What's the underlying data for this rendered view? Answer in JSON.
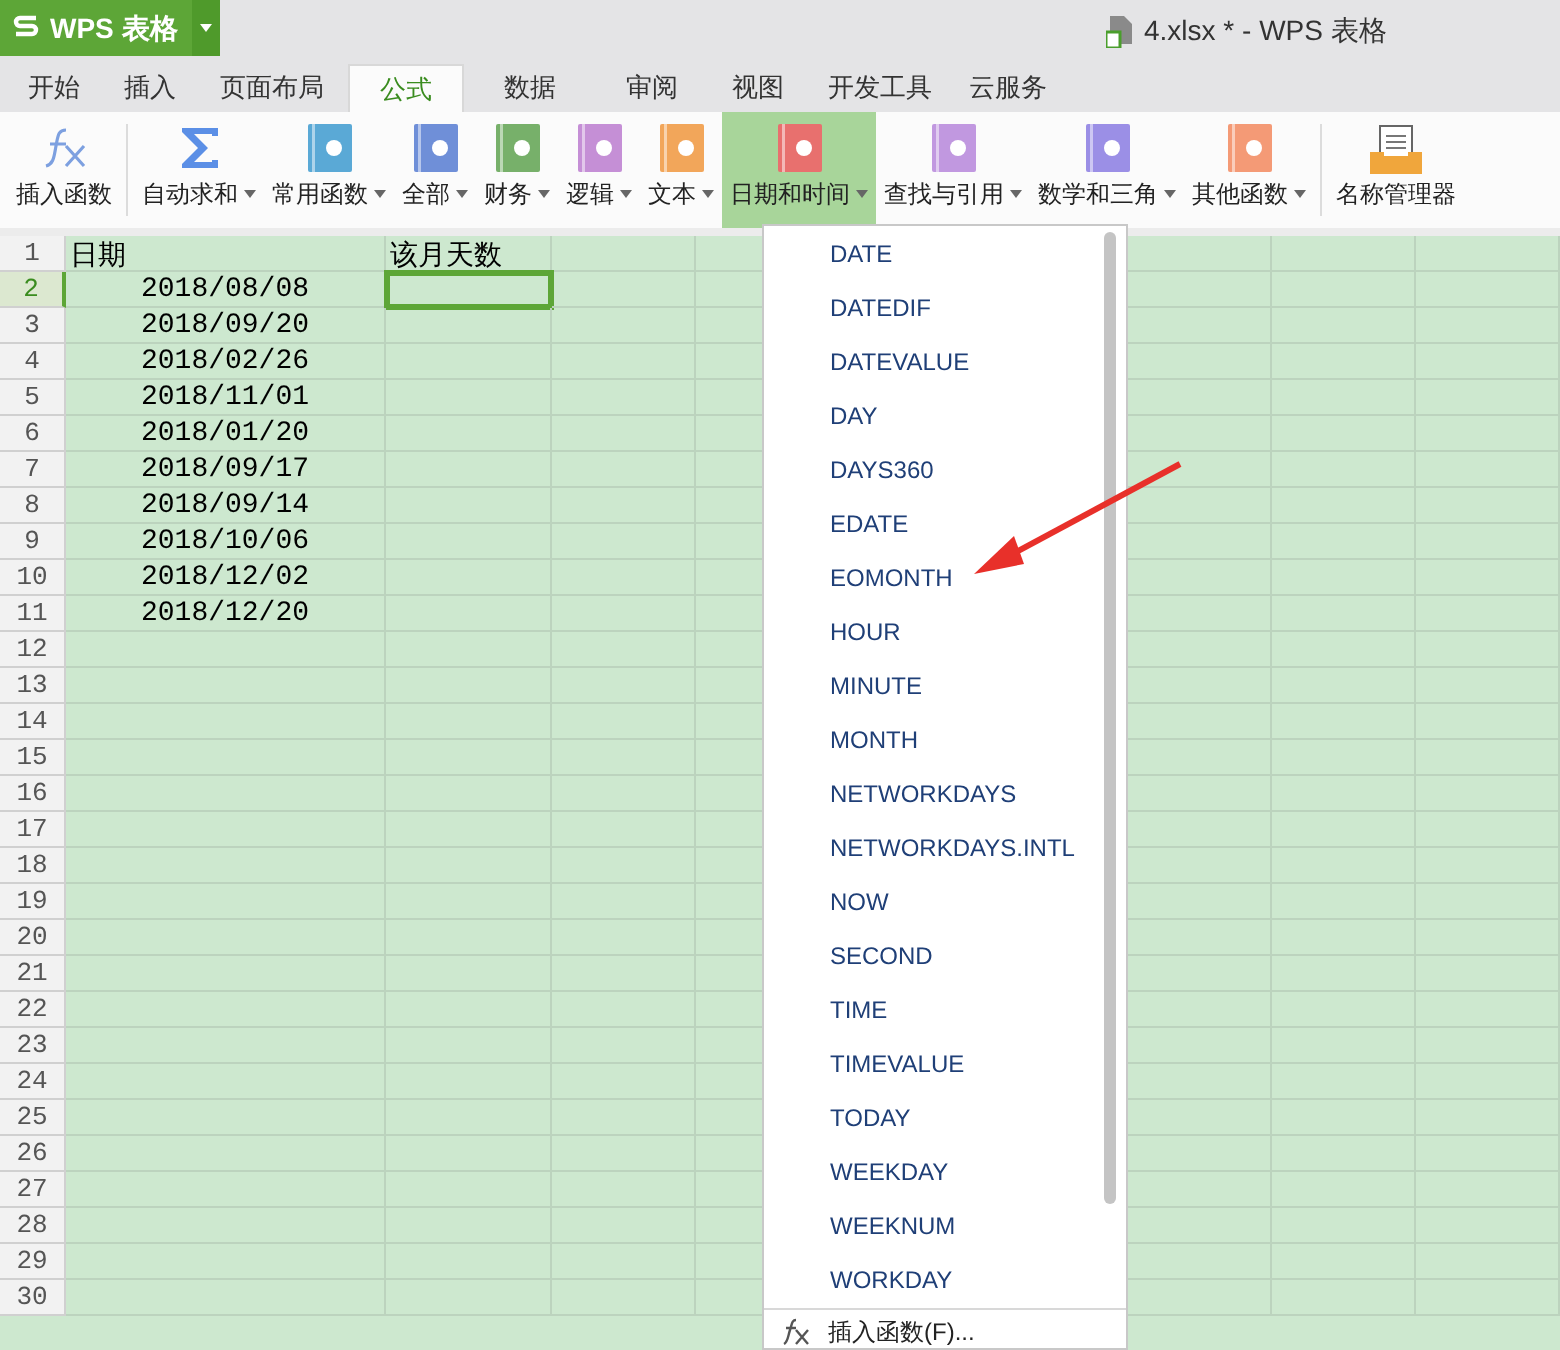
{
  "title_bar": {
    "app_button": "WPS 表格",
    "document_title": "4.xlsx * - WPS 表格"
  },
  "tabs": [
    {
      "label": "开始",
      "selected": false
    },
    {
      "label": "插入",
      "selected": false
    },
    {
      "label": "页面布局",
      "selected": false
    },
    {
      "label": "公式",
      "selected": true
    },
    {
      "label": "数据",
      "selected": false
    },
    {
      "label": "审阅",
      "selected": false
    },
    {
      "label": "视图",
      "selected": false
    },
    {
      "label": "开发工具",
      "selected": false
    },
    {
      "label": "云服务",
      "selected": false
    }
  ],
  "ribbon": [
    {
      "label": "插入函数",
      "kind": "fx",
      "dropdown": false,
      "selected": false
    },
    {
      "label": "自动求和",
      "kind": "sigma",
      "dropdown": true,
      "selected": false
    },
    {
      "label": "常用函数",
      "kind": "book",
      "color": "#5aa9d6",
      "dropdown": true,
      "selected": false
    },
    {
      "label": "全部",
      "kind": "book",
      "color": "#6f8fd8",
      "dropdown": true,
      "selected": false
    },
    {
      "label": "财务",
      "kind": "book",
      "color": "#77b06a",
      "dropdown": true,
      "selected": false
    },
    {
      "label": "逻辑",
      "kind": "book",
      "color": "#c58fd6",
      "dropdown": true,
      "selected": false
    },
    {
      "label": "文本",
      "kind": "book",
      "color": "#f2a65a",
      "dropdown": true,
      "selected": false
    },
    {
      "label": "日期和时间",
      "kind": "book",
      "color": "#e8706e",
      "dropdown": true,
      "selected": true
    },
    {
      "label": "查找与引用",
      "kind": "book",
      "color": "#c198e0",
      "dropdown": true,
      "selected": false
    },
    {
      "label": "数学和三角",
      "kind": "book",
      "color": "#9b8fe6",
      "dropdown": true,
      "selected": false
    },
    {
      "label": "其他函数",
      "kind": "book",
      "color": "#f49a76",
      "dropdown": true,
      "selected": false
    },
    {
      "label": "名称管理器",
      "kind": "folder",
      "dropdown": false,
      "selected": false
    }
  ],
  "sheet": {
    "rows": [
      {
        "number": "1",
        "selected": false,
        "cells": [
          "日期",
          "该月天数"
        ]
      },
      {
        "number": "2",
        "selected": true,
        "cells": [
          "2018/08/08",
          ""
        ]
      },
      {
        "number": "3",
        "selected": false,
        "cells": [
          "2018/09/20"
        ]
      },
      {
        "number": "4",
        "selected": false,
        "cells": [
          "2018/02/26"
        ]
      },
      {
        "number": "5",
        "selected": false,
        "cells": [
          "2018/11/01"
        ]
      },
      {
        "number": "6",
        "selected": false,
        "cells": [
          "2018/01/20"
        ]
      },
      {
        "number": "7",
        "selected": false,
        "cells": [
          "2018/09/17"
        ]
      },
      {
        "number": "8",
        "selected": false,
        "cells": [
          "2018/09/14"
        ]
      },
      {
        "number": "9",
        "selected": false,
        "cells": [
          "2018/10/06"
        ]
      },
      {
        "number": "10",
        "selected": false,
        "cells": [
          "2018/12/02"
        ]
      },
      {
        "number": "11",
        "selected": false,
        "cells": [
          "2018/12/20"
        ]
      },
      {
        "number": "12",
        "selected": false,
        "cells": []
      },
      {
        "number": "13",
        "selected": false,
        "cells": []
      },
      {
        "number": "14",
        "selected": false,
        "cells": []
      },
      {
        "number": "15",
        "selected": false,
        "cells": []
      },
      {
        "number": "16",
        "selected": false,
        "cells": []
      },
      {
        "number": "17",
        "selected": false,
        "cells": []
      },
      {
        "number": "18",
        "selected": false,
        "cells": []
      },
      {
        "number": "19",
        "selected": false,
        "cells": []
      },
      {
        "number": "20",
        "selected": false,
        "cells": []
      },
      {
        "number": "21",
        "selected": false,
        "cells": []
      },
      {
        "number": "22",
        "selected": false,
        "cells": []
      },
      {
        "number": "23",
        "selected": false,
        "cells": []
      },
      {
        "number": "24",
        "selected": false,
        "cells": []
      },
      {
        "number": "25",
        "selected": false,
        "cells": []
      },
      {
        "number": "26",
        "selected": false,
        "cells": []
      },
      {
        "number": "27",
        "selected": false,
        "cells": []
      },
      {
        "number": "28",
        "selected": false,
        "cells": []
      },
      {
        "number": "29",
        "selected": false,
        "cells": []
      },
      {
        "number": "30",
        "selected": false,
        "cells": []
      }
    ]
  },
  "dropdown": {
    "items": [
      "DATE",
      "DATEDIF",
      "DATEVALUE",
      "DAY",
      "DAYS360",
      "EDATE",
      "EOMONTH",
      "HOUR",
      "MINUTE",
      "MONTH",
      "NETWORKDAYS",
      "NETWORKDAYS.INTL",
      "NOW",
      "SECOND",
      "TIME",
      "TIMEVALUE",
      "TODAY",
      "WEEKDAY",
      "WEEKNUM",
      "WORKDAY"
    ],
    "footer": "插入函数(F)..."
  }
}
